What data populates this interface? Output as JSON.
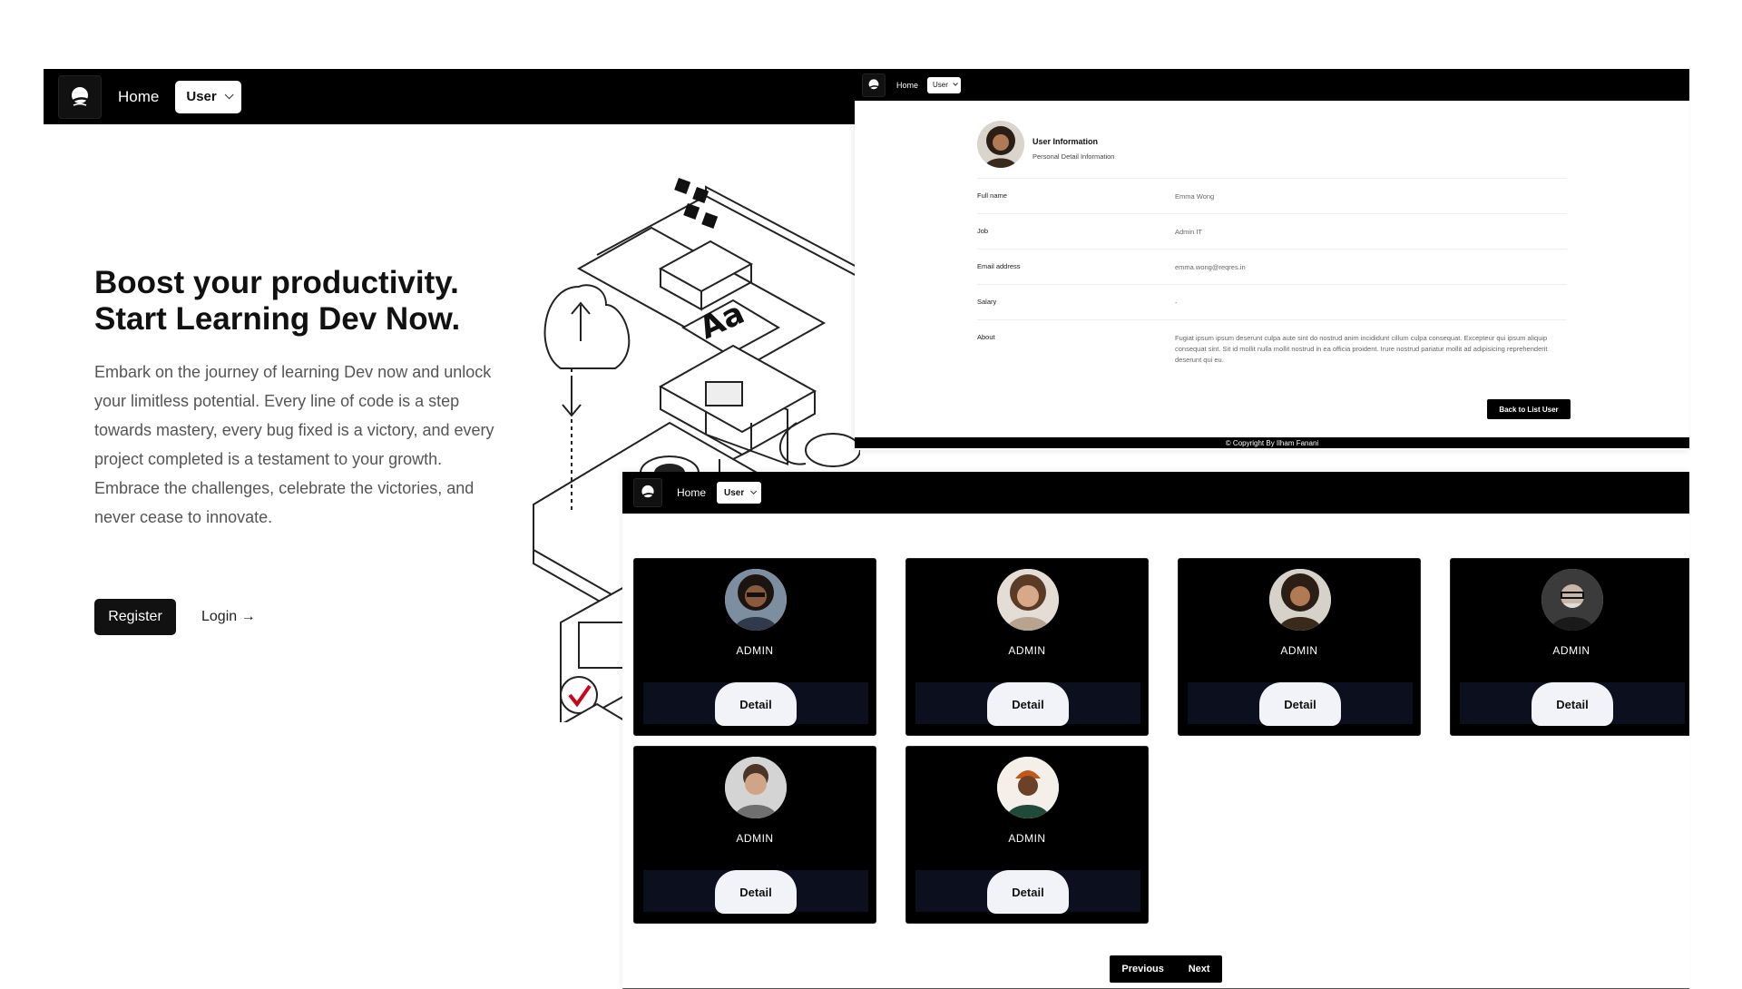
{
  "landing": {
    "nav": {
      "home": "Home",
      "user": "User"
    },
    "hero": {
      "title_line1": "Boost your productivity.",
      "title_line2": "Start Learning Dev Now.",
      "description": "Embark on the journey of learning Dev now and unlock your limitless potential. Every line of code is a step towards mastery, every bug fixed is a victory, and every project completed is a testament to your growth. Embrace the challenges, celebrate the victories, and never cease to innovate.",
      "register": "Register",
      "login": "Login →"
    }
  },
  "detail": {
    "nav": {
      "home": "Home",
      "user": "User"
    },
    "header": {
      "title": "User Information",
      "subtitle": "Personal Detail Information"
    },
    "fields": [
      {
        "label": "Full name",
        "value": "Emma Wong"
      },
      {
        "label": "Job",
        "value": "Admin IT"
      },
      {
        "label": "Email address",
        "value": "emma.wong@reqres.in"
      },
      {
        "label": "Salary",
        "value": "-"
      },
      {
        "label": "About",
        "value": "Fugiat ipsum ipsum deserunt culpa aute sint do nostrud anim incididunt cillum culpa consequat. Excepteur qui ipsum aliquip consequat sint. Sit id mollit nulla mollit nostrud in ea officia proident. Irure nostrud pariatur mollit ad adipisicing reprehenderit deserunt qui eu."
      }
    ],
    "back_button": "Back to List User",
    "footer": "© Copyright By Ilham Fanani"
  },
  "list": {
    "nav": {
      "home": "Home",
      "user": "User"
    },
    "cards": [
      {
        "role": "ADMIN",
        "button": "Detail"
      },
      {
        "role": "ADMIN",
        "button": "Detail"
      },
      {
        "role": "ADMIN",
        "button": "Detail"
      },
      {
        "role": "ADMIN",
        "button": "Detail"
      },
      {
        "role": "ADMIN",
        "button": "Detail"
      },
      {
        "role": "ADMIN",
        "button": "Detail"
      }
    ],
    "pagination": {
      "previous": "Previous",
      "next": "Next"
    }
  },
  "colors": {
    "nav_bg": "#000000",
    "card_bg": "#000000",
    "button_bg": "#f1f3f8",
    "text_muted": "#555555"
  }
}
